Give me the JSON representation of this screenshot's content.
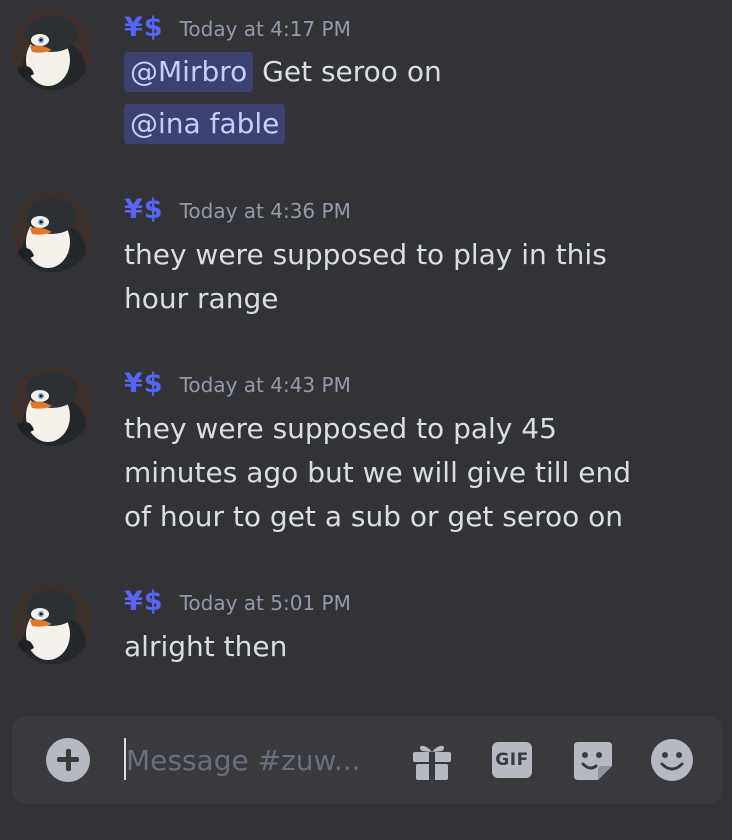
{
  "colors": {
    "background": "#313338",
    "username": "#5865f2",
    "timestamp": "#949ba4",
    "text": "#dbdee1",
    "mention_bg": "#3c4270",
    "composer_bg": "#383a40"
  },
  "messages": [
    {
      "username": "¥$",
      "timestamp": "Today at 4:17 PM",
      "mention1": "@Mirbro",
      "text1": " Get seroo on",
      "mention2": "@ina fable"
    },
    {
      "username": "¥$",
      "timestamp": "Today at 4:36 PM",
      "lines": [
        "they were supposed to play in this",
        "hour range"
      ]
    },
    {
      "username": "¥$",
      "timestamp": "Today at 4:43 PM",
      "lines": [
        "they were supposed to paly 45",
        "minutes ago but we will give till end",
        "of hour to get a sub or get seroo on"
      ]
    },
    {
      "username": "¥$",
      "timestamp": "Today at 5:01 PM",
      "lines": [
        "alright then"
      ]
    }
  ],
  "composer": {
    "placeholder": "Message #zuw...",
    "value": "",
    "gif_label": "GIF",
    "icons": [
      "add-icon",
      "gift-icon",
      "gif-icon",
      "sticker-icon",
      "emoji-icon"
    ]
  }
}
